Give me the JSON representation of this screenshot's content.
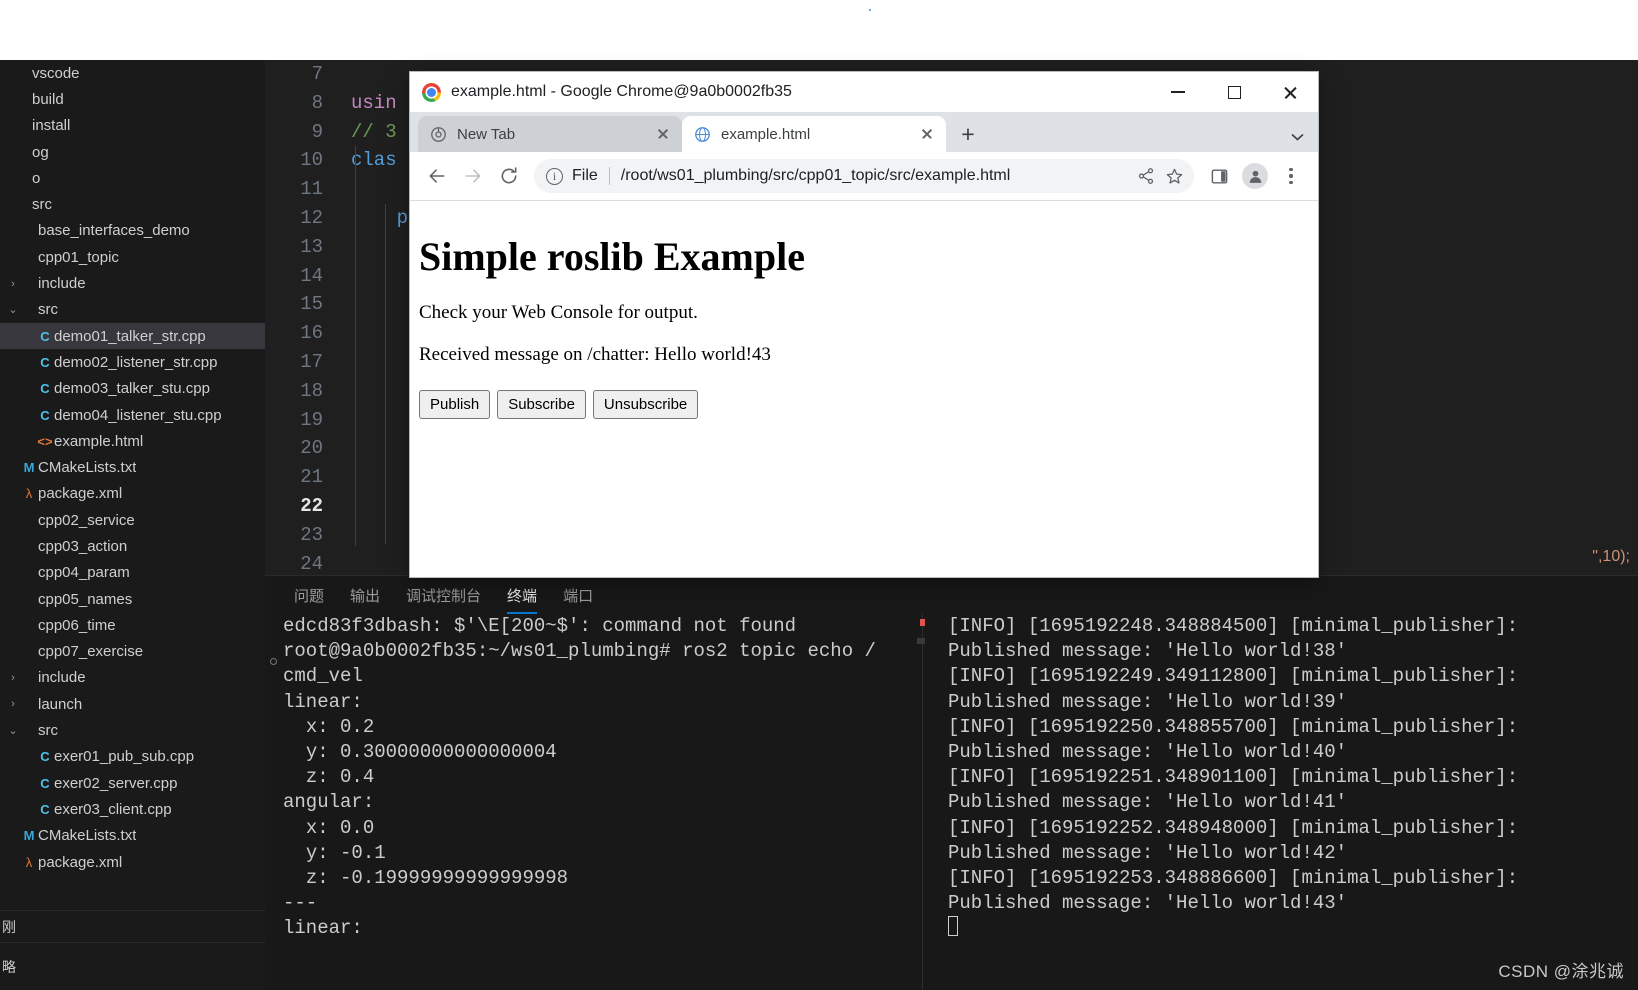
{
  "vscode": {
    "sidebar": {
      "items": [
        {
          "twisty": "",
          "icon": "",
          "label": "vscode",
          "indent": 0,
          "selected": false
        },
        {
          "twisty": "",
          "icon": "",
          "label": "build",
          "indent": 0,
          "selected": false
        },
        {
          "twisty": "",
          "icon": "",
          "label": "install",
          "indent": 0,
          "selected": false
        },
        {
          "twisty": "",
          "icon": "",
          "label": "og",
          "indent": 0,
          "selected": false
        },
        {
          "twisty": "",
          "icon": "",
          "label": "o",
          "indent": 0,
          "selected": false
        },
        {
          "twisty": "",
          "icon": "",
          "label": "src",
          "indent": 0,
          "selected": false
        },
        {
          "twisty": "",
          "icon": "",
          "label": "base_interfaces_demo",
          "indent": 1,
          "selected": false
        },
        {
          "twisty": "",
          "icon": "",
          "label": "cpp01_topic",
          "indent": 1,
          "selected": false
        },
        {
          "twisty": ">",
          "icon": "",
          "label": "include",
          "indent": 1,
          "selected": false
        },
        {
          "twisty": "v",
          "icon": "",
          "label": "src",
          "indent": 1,
          "selected": false
        },
        {
          "twisty": "",
          "icon": "cpp",
          "label": "demo01_talker_str.cpp",
          "indent": 2,
          "selected": true
        },
        {
          "twisty": "",
          "icon": "cpp",
          "label": "demo02_listener_str.cpp",
          "indent": 2,
          "selected": false
        },
        {
          "twisty": "",
          "icon": "cpp",
          "label": "demo03_talker_stu.cpp",
          "indent": 2,
          "selected": false
        },
        {
          "twisty": "",
          "icon": "cpp",
          "label": "demo04_listener_stu.cpp",
          "indent": 2,
          "selected": false
        },
        {
          "twisty": "",
          "icon": "html",
          "label": "example.html",
          "indent": 2,
          "selected": false
        },
        {
          "twisty": "",
          "icon": "cmake",
          "label": "CMakeLists.txt",
          "indent": 1,
          "selected": false
        },
        {
          "twisty": "",
          "icon": "xml",
          "label": "package.xml",
          "indent": 1,
          "selected": false
        },
        {
          "twisty": "",
          "icon": "",
          "label": "cpp02_service",
          "indent": 1,
          "selected": false
        },
        {
          "twisty": "",
          "icon": "",
          "label": "cpp03_action",
          "indent": 1,
          "selected": false
        },
        {
          "twisty": "",
          "icon": "",
          "label": "cpp04_param",
          "indent": 1,
          "selected": false
        },
        {
          "twisty": "",
          "icon": "",
          "label": "cpp05_names",
          "indent": 1,
          "selected": false
        },
        {
          "twisty": "",
          "icon": "",
          "label": "cpp06_time",
          "indent": 1,
          "selected": false
        },
        {
          "twisty": "",
          "icon": "",
          "label": "cpp07_exercise",
          "indent": 1,
          "selected": false
        },
        {
          "twisty": ">",
          "icon": "",
          "label": "include",
          "indent": 1,
          "selected": false
        },
        {
          "twisty": ">",
          "icon": "",
          "label": "launch",
          "indent": 1,
          "selected": false
        },
        {
          "twisty": "v",
          "icon": "",
          "label": "src",
          "indent": 1,
          "selected": false
        },
        {
          "twisty": "",
          "icon": "cpp",
          "label": "exer01_pub_sub.cpp",
          "indent": 2,
          "selected": false
        },
        {
          "twisty": "",
          "icon": "cpp",
          "label": "exer02_server.cpp",
          "indent": 2,
          "selected": false
        },
        {
          "twisty": "",
          "icon": "cpp",
          "label": "exer03_client.cpp",
          "indent": 2,
          "selected": false
        },
        {
          "twisty": "",
          "icon": "cmake",
          "label": "CMakeLists.txt",
          "indent": 1,
          "selected": false
        },
        {
          "twisty": "",
          "icon": "xml",
          "label": "package.xml",
          "indent": 1,
          "selected": false
        }
      ],
      "collapsed_panels": [
        {
          "label": "刚"
        },
        {
          "label": "略"
        }
      ]
    },
    "editor": {
      "line_numbers": [
        "7",
        "8",
        "9",
        "10",
        "11",
        "12",
        "13",
        "14",
        "15",
        "16",
        "17",
        "18",
        "19",
        "20",
        "21",
        "22",
        "23",
        "24"
      ],
      "active_line": "22",
      "code_lines": [
        {
          "num": "7",
          "text": "",
          "cls": "kw-plain"
        },
        {
          "num": "8",
          "text": "usin",
          "cls": "kw-pink"
        },
        {
          "num": "9",
          "text": "// 3",
          "cls": "kw-green"
        },
        {
          "num": "10",
          "text": "clas",
          "cls": "kw-blue"
        },
        {
          "num": "11",
          "text": "",
          "cls": "kw-plain"
        },
        {
          "num": "12",
          "text": "    pu",
          "cls": "kw-blue"
        },
        {
          "num": "13",
          "text": "",
          "cls": "kw-plain"
        },
        {
          "num": "14",
          "text": "",
          "cls": "kw-plain"
        },
        {
          "num": "15",
          "text": "",
          "cls": "kw-plain"
        },
        {
          "num": "16",
          "text": "",
          "cls": "kw-plain"
        },
        {
          "num": "17",
          "text": "",
          "cls": "kw-plain"
        },
        {
          "num": "18",
          "text": "",
          "cls": "kw-plain"
        },
        {
          "num": "19",
          "text": "",
          "cls": "kw-plain"
        },
        {
          "num": "20",
          "text": "",
          "cls": "kw-plain"
        },
        {
          "num": "21",
          "text": "",
          "cls": "kw-plain"
        },
        {
          "num": "22",
          "text": "",
          "cls": "kw-plain"
        },
        {
          "num": "23",
          "text": "",
          "cls": "kw-plain"
        },
        {
          "num": "24",
          "text": "",
          "cls": "kw-plain"
        }
      ],
      "tail_fragment": "\",10);"
    },
    "panel": {
      "tabs": [
        {
          "label": "问题",
          "active": false
        },
        {
          "label": "输出",
          "active": false
        },
        {
          "label": "调试控制台",
          "active": false
        },
        {
          "label": "终端",
          "active": true
        },
        {
          "label": "端口",
          "active": false
        }
      ],
      "terminal_left": [
        "edcd83f3dbash: $'\\E[200~$': command not found",
        "root@9a0b0002fb35:~/ws01_plumbing# ros2 topic echo /",
        "cmd_vel",
        "linear:",
        "  x: 0.2",
        "  y: 0.30000000000000004",
        "  z: 0.4",
        "angular:",
        "  x: 0.0",
        "  y: -0.1",
        "  z: -0.19999999999999998",
        "---",
        "linear:"
      ],
      "terminal_right": [
        "[INFO] [1695192248.348884500] [minimal_publisher]:",
        "Published message: 'Hello world!38'",
        "[INFO] [1695192249.349112800] [minimal_publisher]:",
        "Published message: 'Hello world!39'",
        "[INFO] [1695192250.348855700] [minimal_publisher]:",
        "Published message: 'Hello world!40'",
        "[INFO] [1695192251.348901100] [minimal_publisher]:",
        "Published message: 'Hello world!41'",
        "[INFO] [1695192252.348948000] [minimal_publisher]:",
        "Published message: 'Hello world!42'",
        "[INFO] [1695192253.348886600] [minimal_publisher]:",
        "Published message: 'Hello world!43'"
      ]
    },
    "watermark": "CSDN @涂兆诚"
  },
  "chrome": {
    "window_title": "example.html - Google Chrome@9a0b0002fb35",
    "window_controls": {
      "minimize": "minimize-icon",
      "maximize": "maximize-icon",
      "close": "close-icon"
    },
    "tabs": [
      {
        "label": "New Tab",
        "active": false,
        "favicon": "chrome-new-tab-icon"
      },
      {
        "label": "example.html",
        "active": true,
        "favicon": "globe-icon"
      }
    ],
    "new_tab_label": "+",
    "toolbar": {
      "back": "back-arrow-icon",
      "forward": "forward-arrow-icon",
      "reload": "reload-icon",
      "file_label": "File",
      "url": "/root/ws01_plumbing/src/cpp01_topic/src/example.html",
      "share": "share-icon",
      "bookmark": "star-icon",
      "sidepanel": "side-panel-icon",
      "profile": "profile-avatar-icon",
      "menu": "three-dot-menu-icon"
    },
    "page": {
      "heading": "Simple roslib Example",
      "paragraph1": "Check your Web Console for output.",
      "paragraph2": "Received message on /chatter: Hello world!43",
      "buttons": [
        {
          "label": "Publish"
        },
        {
          "label": "Subscribe"
        },
        {
          "label": "Unsubscribe"
        }
      ]
    }
  }
}
